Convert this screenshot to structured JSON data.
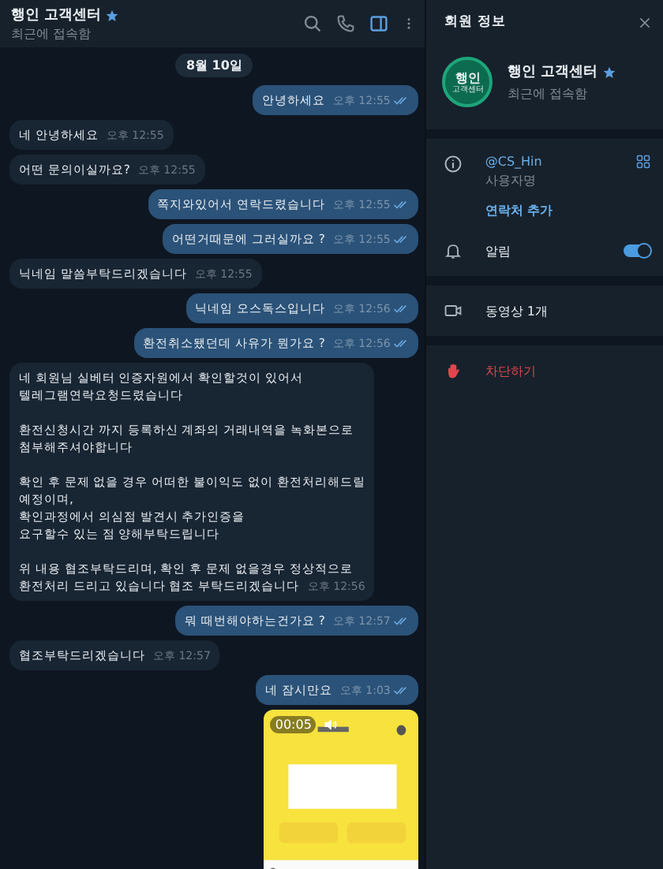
{
  "chat": {
    "title": "행인 고객센터",
    "status": "최근에 접속함",
    "date": "8월 10일"
  },
  "messages": [
    {
      "kind": "out",
      "lines": [
        "안녕하세요"
      ],
      "time": "오후 12:55",
      "read": true
    },
    {
      "kind": "in",
      "lines": [
        "네 안녕하세요"
      ],
      "time": "오후 12:55",
      "read": false
    },
    {
      "kind": "in",
      "lines": [
        "어떤 문의이실까요?"
      ],
      "time": "오후 12:55",
      "read": false
    },
    {
      "kind": "out",
      "lines": [
        "쪽지와있어서 연락드렸습니다"
      ],
      "time": "오후 12:55",
      "read": true
    },
    {
      "kind": "out",
      "lines": [
        "어떤거때문에 그러실까요 ?"
      ],
      "time": "오후 12:55",
      "read": true
    },
    {
      "kind": "in",
      "lines": [
        "닉네임 말씀부탁드리겠습니다"
      ],
      "time": "오후 12:55",
      "read": false
    },
    {
      "kind": "out",
      "lines": [
        "닉네임 오스독스입니다"
      ],
      "time": "오후 12:56",
      "read": true
    },
    {
      "kind": "out",
      "lines": [
        "환전취소됐던데 사유가 뭔가요 ?"
      ],
      "time": "오후 12:56",
      "read": true
    },
    {
      "kind": "in",
      "paragraphs": [
        [
          "네 회원님 실베터 인증자원에서 확인할것이 있어서",
          "텔레그램연락요청드렸습니다"
        ],
        [
          "환전신청시간 까지 등록하신 계좌의 거래내역을 녹화본으로",
          "첨부해주셔야합니다"
        ],
        [
          "확인 후 문제 없을 경우 어떠한 불이익도 없이 환전처리해드릴",
          "예정이며,",
          "확인과정에서 의심점 발견시 추가인증을",
          "요구할수 있는 점 양해부탁드립니다"
        ],
        [
          "위 내용 협조부탁드리며, 확인 후 문제 없을경우 정상적으로",
          "환전처리 드리고 있습니다 협조 부탁드리겠습니다"
        ]
      ],
      "time": "오후 12:56",
      "read": false
    },
    {
      "kind": "out",
      "lines": [
        "뭐 때번해야하는건가요 ?"
      ],
      "time": "오후 12:57",
      "read": true
    },
    {
      "kind": "in",
      "lines": [
        "협조부탁드리겠습니다"
      ],
      "time": "오후 12:57",
      "read": false
    },
    {
      "kind": "out",
      "lines": [
        "네 잠시만요"
      ],
      "time": "오후 1:03",
      "read": true
    },
    {
      "kind": "video",
      "duration": "00:05"
    }
  ],
  "panel": {
    "title": "회원 정보",
    "avatar_lines": [
      "행인",
      "고객센터"
    ],
    "name": "행인 고객센터",
    "status": "최근에 접속함",
    "username": "@CS_Hin",
    "username_label": "사용자명",
    "add_contact": "연락처 추가",
    "notifications": {
      "label": "알림",
      "on": true
    },
    "media": "동영상 1개",
    "block": "차단하기"
  }
}
